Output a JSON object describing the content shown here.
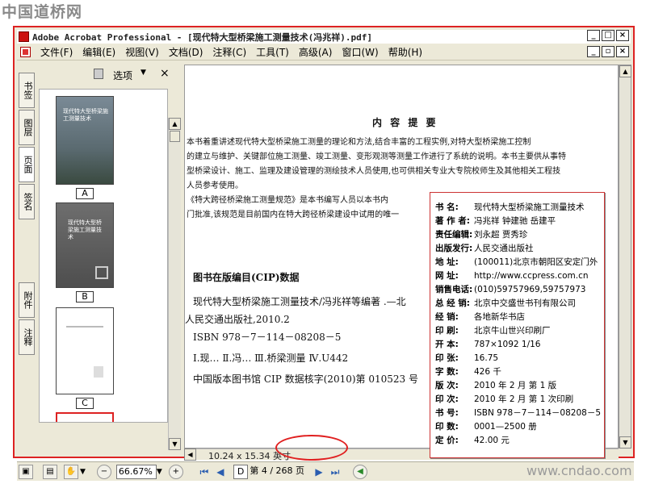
{
  "watermarks": {
    "top": "中国道桥网",
    "bottom": "www.cndao.com"
  },
  "window": {
    "title": "Adobe Acrobat Professional - [现代特大型桥梁施工测量技术(冯兆祥).pdf]",
    "buttons": [
      "_",
      "□",
      "×"
    ],
    "doc_buttons": [
      "_",
      "▫",
      "×"
    ]
  },
  "menu": [
    "文件(F)",
    "编辑(E)",
    "视图(V)",
    "文档(D)",
    "注释(C)",
    "工具(T)",
    "高级(A)",
    "窗口(W)",
    "帮助(H)"
  ],
  "nav_tabs": [
    "书签",
    "图层",
    "页面",
    "签名",
    "附件",
    "注释"
  ],
  "thumb_panel": {
    "options_label": "选项",
    "close": "×",
    "thumbnails": [
      {
        "label": "A",
        "cover_title": "现代特大型桥梁施工测量技术"
      },
      {
        "label": "B",
        "cover_title": "现代特大型桥梁施工测量技术"
      },
      {
        "label": "C"
      }
    ]
  },
  "document": {
    "section_title": "内 容 提 要",
    "summary_lines": [
      "    本书着重讲述现代特大型桥梁施工测量的理论和方法,结合丰富的工程实例,对特大型桥梁施工控制",
      "的建立与维护、关键部位施工测量、竣工测量、变形观测等测量工作进行了系统的说明。本书主要供从事特",
      "型桥梁设计、施工、监理及建设管理的测绘技术人员使用,也可供相关专业大专院校师生及其他相关工程技",
      "人员参考使用。",
      "    《特大跨径桥梁施工测量规范》是本书编写人员以本书内",
      "门批准,该规范是目前国内在特大跨径桥梁建设中试用的唯一"
    ],
    "cip_title": "图书在版编目(CIP)数据",
    "cip_lines": [
      "现代特大型桥梁施工测量技术/冯兆祥等编著 .—北",
      "人民交通出版社,2010.2",
      "ISBN 978－7－114－08208－5",
      "Ⅰ.现…  Ⅱ.冯…  Ⅲ.桥梁测量  Ⅳ.U442",
      "中国版本图书馆 CIP 数据核字(2010)第 010523 号"
    ],
    "page_size": "10.24 x 15.34 英寸"
  },
  "statusbar": {
    "zoom": "66.67%",
    "page_indicator": "第 4 / 268 页",
    "page_input": "D"
  },
  "info_box": {
    "rows": [
      {
        "key": "书    名:",
        "val": "现代特大型桥梁施工测量技术"
      },
      {
        "key": "著 作 者:",
        "val": "冯兆祥  钟建驰  岳建平"
      },
      {
        "key": "责任编辑:",
        "val": "刘永超  贾秀珍"
      },
      {
        "key": "出版发行:",
        "val": "人民交通出版社"
      },
      {
        "key": "地    址:",
        "val": "(100011)北京市朝阳区安定门外"
      },
      {
        "key": "网    址:",
        "val": "http://www.ccpress.com.cn"
      },
      {
        "key": "销售电话:",
        "val": "(010)59757969,59757973"
      },
      {
        "key": "总 经 销:",
        "val": "北京中交盛世书刊有限公司"
      },
      {
        "key": "经    销:",
        "val": "各地新华书店"
      },
      {
        "key": "印    刷:",
        "val": "北京牛山世兴印刷厂"
      },
      {
        "key": "开    本:",
        "val": "787×1092   1/16"
      },
      {
        "key": "印    张:",
        "val": "16.75"
      },
      {
        "key": "字    数:",
        "val": "426 千"
      },
      {
        "key": "版    次:",
        "val": "2010 年 2 月   第 1 版"
      },
      {
        "key": "印    次:",
        "val": "2010 年 2 月   第 1 次印刷"
      },
      {
        "key": "书    号:",
        "val": "ISBN 978－7－114－08208－5"
      },
      {
        "key": "印    数:",
        "val": "0001—2500 册"
      },
      {
        "key": "定    价:",
        "val": "42.00 元"
      }
    ]
  },
  "colors": {
    "accent_red": "#e02020",
    "window_bg": "#ece9d8"
  }
}
